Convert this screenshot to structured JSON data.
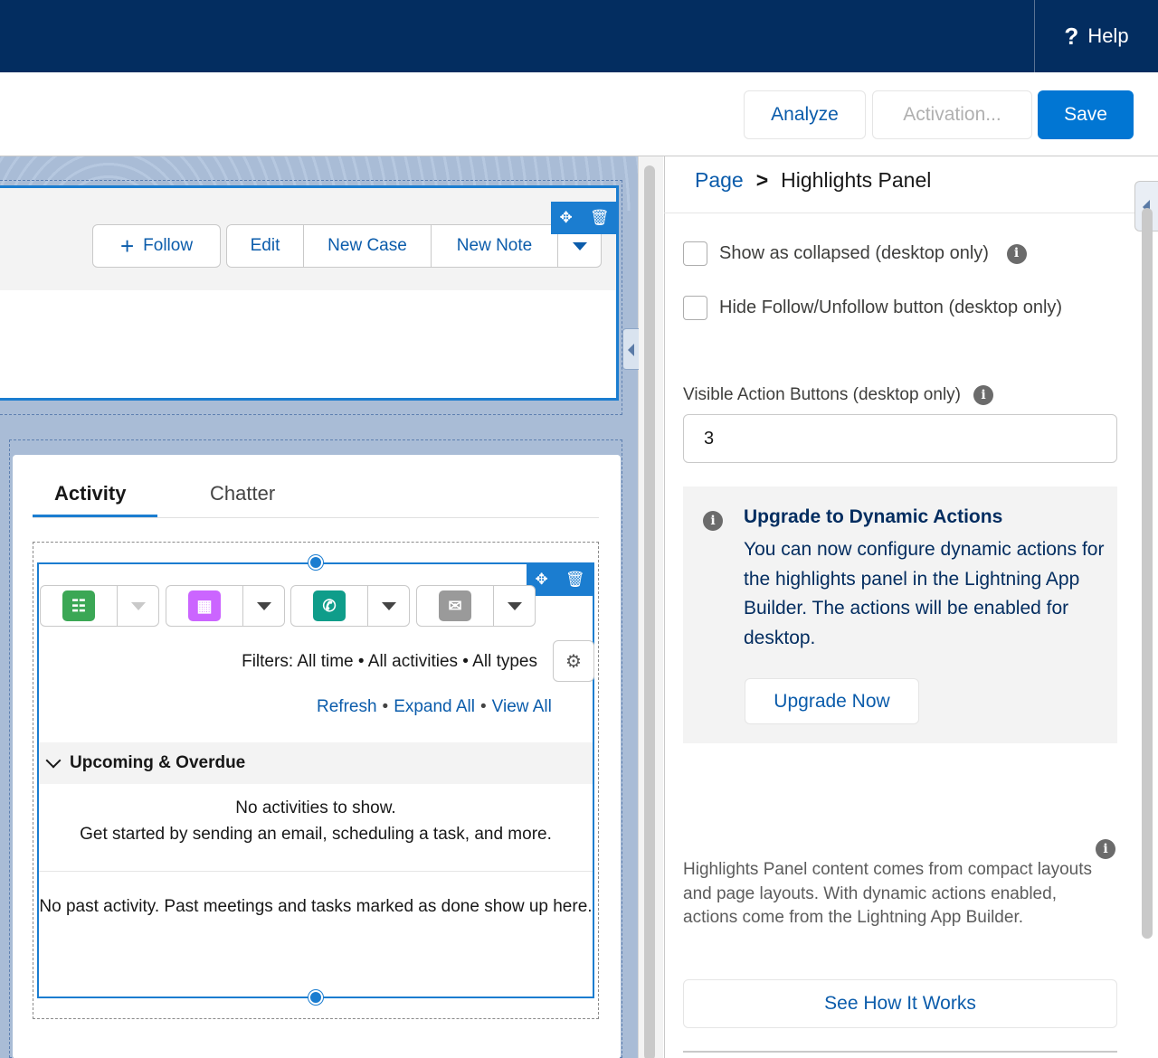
{
  "header": {
    "help_glyph": "?",
    "help_label": "Help"
  },
  "toolbar": {
    "analyze_label": "Analyze",
    "activation_label": "Activation...",
    "save_label": "Save"
  },
  "highlights": {
    "follow_label": "Follow",
    "actions": [
      "Edit",
      "New Case",
      "New Note"
    ]
  },
  "tabs": {
    "items": [
      "Activity",
      "Chatter"
    ],
    "selected": "Activity"
  },
  "activity": {
    "filters_text": "Filters: All time • All activities • All types",
    "links": [
      "Refresh",
      "Expand All",
      "View All"
    ],
    "section_title": "Upcoming & Overdue",
    "empty_line1": "No activities to show.",
    "empty_line2": "Get started by sending an email, scheduling a task, and more.",
    "past_text": "No past activity. Past meetings and tasks marked as done show up here.",
    "publisher_icons": [
      "task-icon",
      "event-icon",
      "call-icon",
      "email-icon"
    ],
    "colors": {
      "task": "#3ba755",
      "event": "#cb65ff",
      "call": "#0f9d8a",
      "email": "#9a9a9a"
    }
  },
  "properties": {
    "breadcrumb_root": "Page",
    "breadcrumb_sep": ">",
    "breadcrumb_current": "Highlights Panel",
    "show_collapsed_label": "Show as collapsed (desktop only)",
    "hide_follow_label": "Hide Follow/Unfollow button (desktop only)",
    "visible_buttons_label": "Visible Action Buttons (desktop only)",
    "visible_buttons_value": "3",
    "notice_title": "Upgrade to Dynamic Actions",
    "notice_body": "You can now configure dynamic actions for the highlights panel in the Lightning App Builder. The actions will be enabled for desktop.",
    "upgrade_label": "Upgrade Now",
    "footer_text": "Highlights Panel content comes from compact layouts and page layouts. With dynamic actions enabled, actions come from the Lightning App Builder.",
    "see_how_label": "See How It Works"
  },
  "colors": {
    "nav": "#032d60",
    "brand": "#0176d3",
    "selection": "#1b7dd0",
    "link": "#0b5cab"
  }
}
